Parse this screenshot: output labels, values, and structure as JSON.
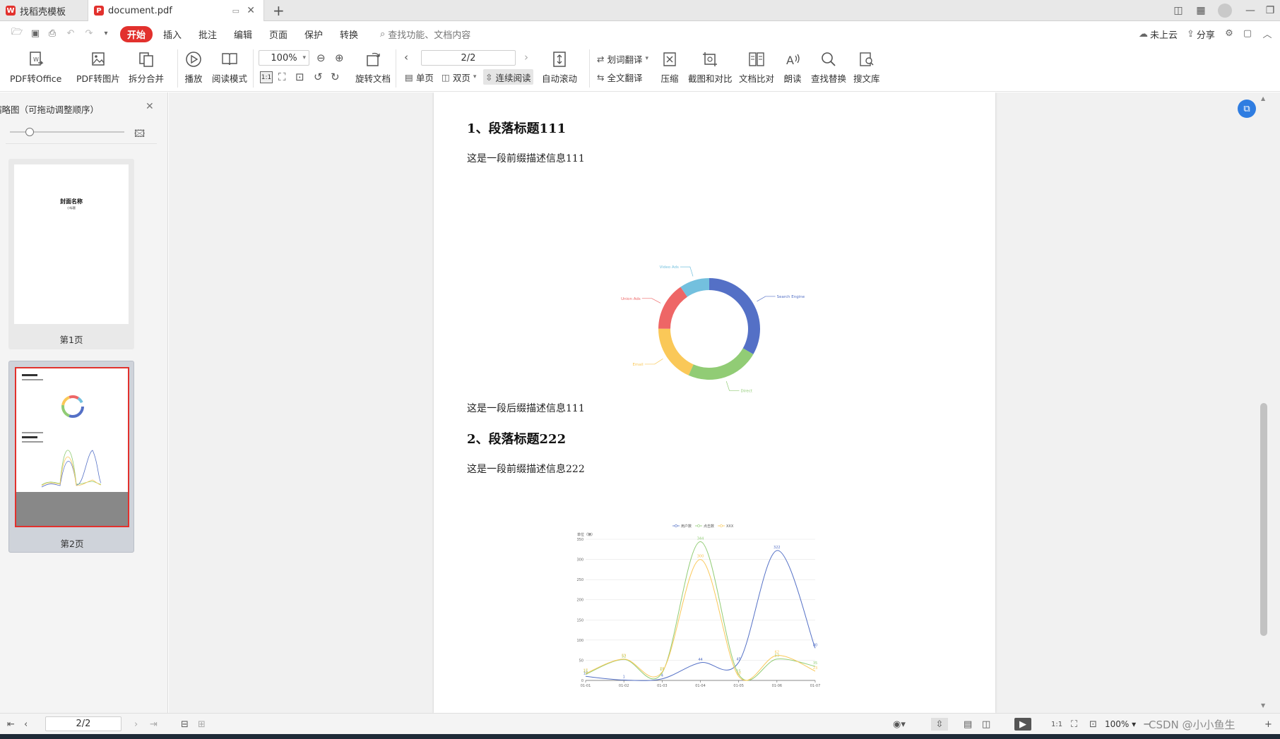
{
  "titlebar": {
    "tabs": [
      {
        "label": "找稻壳模板"
      },
      {
        "label": "document.pdf"
      }
    ]
  },
  "menubar": {
    "items": [
      {
        "label": "开始",
        "active": true
      },
      {
        "label": "插入"
      },
      {
        "label": "批注"
      },
      {
        "label": "编辑"
      },
      {
        "label": "页面"
      },
      {
        "label": "保护"
      },
      {
        "label": "转换"
      }
    ],
    "search_placeholder": "查找功能、文档内容",
    "cloud_label": "未上云",
    "share_label": "分享"
  },
  "ribbon": {
    "pdf_to_office": "PDF转Office",
    "pdf_to_image": "PDF转图片",
    "split_merge": "拆分合并",
    "play": "播放",
    "read_mode": "阅读模式",
    "zoom_value": "100%",
    "rotate_doc": "旋转文档",
    "page_value": "2/2",
    "single_page": "单页",
    "double_page": "双页",
    "continuous_read": "连续阅读",
    "auto_scroll": "自动滚动",
    "word_translate": "划词翻译",
    "full_translate": "全文翻译",
    "compress": "压缩",
    "screenshot_compare": "截图和对比",
    "doc_compare": "文档比对",
    "read_aloud": "朗读",
    "find_replace": "查找替换",
    "search_library": "搜文库",
    "accent": "#e2312d"
  },
  "leftpanel": {
    "title": "缩略图（可拖动调整顺序）",
    "thumbnails": [
      {
        "label": "第1页",
        "cover_title": "封面名称",
        "cover_sub": "小标题"
      },
      {
        "label": "第2页"
      }
    ]
  },
  "document": {
    "heading1": "1、段落标题111",
    "para1": "这是一段前缀描述信息111",
    "para2": "这是一段后缀描述信息111",
    "heading2": "2、段落标题222",
    "para3": "这是一段前缀描述信息222"
  },
  "chart_data": [
    {
      "type": "pie",
      "variant": "donut",
      "labels": [
        "Search Engine",
        "Direct",
        "Email",
        "Union Ads",
        "Video Ads"
      ],
      "values": [
        1048,
        735,
        580,
        484,
        300
      ],
      "colors": [
        "#5470c6",
        "#91cc75",
        "#fac858",
        "#ee6666",
        "#73c0de"
      ]
    },
    {
      "type": "line",
      "smooth": true,
      "title": "",
      "ylabel": "单位（辆）",
      "legend": [
        "用户数",
        "点击数",
        "XXX"
      ],
      "x": [
        "01-01",
        "01-02",
        "01-03",
        "01-04",
        "01-05",
        "01-06",
        "01-07"
      ],
      "ylim": [
        0,
        350
      ],
      "yticks": [
        0,
        50,
        100,
        150,
        200,
        250,
        300,
        350
      ],
      "series": [
        {
          "name": "用户数",
          "color": "#5470c6",
          "values": [
            10,
            1,
            4,
            44,
            45,
            322,
            80
          ]
        },
        {
          "name": "点击数",
          "color": "#91cc75",
          "values": [
            15,
            52,
            19,
            344,
            15,
            53,
            35
          ]
        },
        {
          "name": "XXX",
          "color": "#fac858",
          "values": [
            17,
            53,
            21,
            300,
            10,
            62,
            23
          ]
        }
      ],
      "data_labels": [
        {
          "series": 0,
          "values": [
            "10",
            "1",
            "4",
            "44",
            "45",
            "322",
            "80"
          ]
        },
        {
          "series": 1,
          "values": [
            "15",
            "52",
            "19",
            "344",
            "15",
            "53",
            "35"
          ]
        },
        {
          "series": 2,
          "values": [
            "17",
            "53",
            "21",
            "300",
            "10",
            "62",
            "23"
          ]
        }
      ]
    }
  ],
  "statusbar": {
    "page_value": "2/2",
    "zoom_value": "100%",
    "watermark": "CSDN @小小鱼生"
  }
}
